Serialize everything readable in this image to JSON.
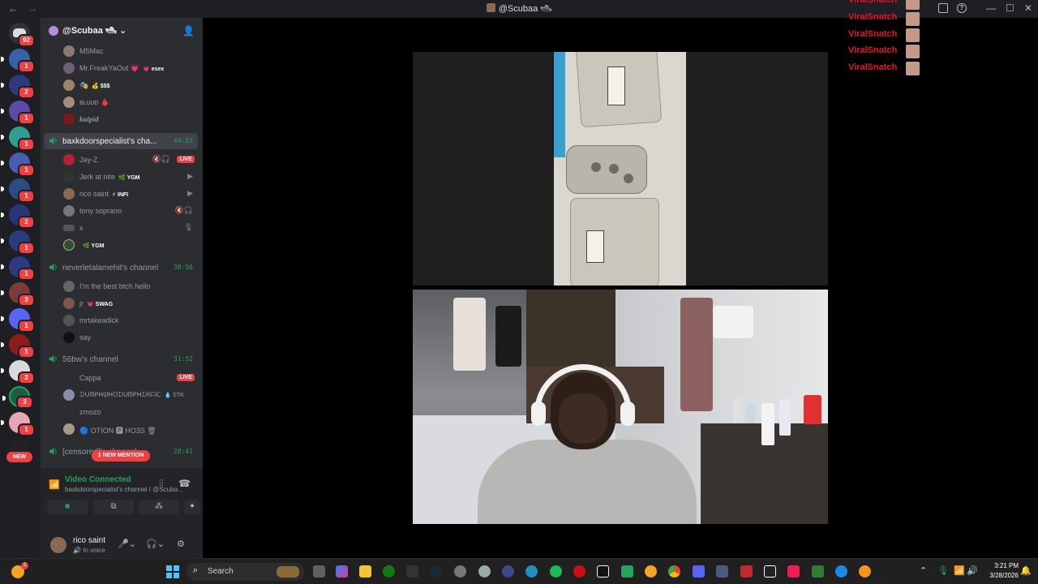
{
  "window": {
    "title": "@Scubaa 🛥",
    "nav_back": "←",
    "nav_forward": "→"
  },
  "server_rail": {
    "home_badge": "92",
    "badges": [
      "1",
      "2",
      "1",
      "1",
      "1",
      "1",
      "2",
      "1",
      "1",
      "3",
      "1",
      "1",
      "2",
      "3",
      "1"
    ],
    "new_pill": "NEW"
  },
  "sidebar": {
    "server_name": "@Scubaa 🛥",
    "members_top": [
      {
        "name": "M5Mac",
        "tag": ""
      },
      {
        "name": "Mr.FreakYaOut 💗",
        "tag": "💗 esex"
      },
      {
        "name": "🎭",
        "tag": "💰 $$$"
      },
      {
        "name": "ʙʟᴜᴜᴅ 🩸",
        "tag": ""
      },
      {
        "name": "kuipid",
        "tag": ""
      }
    ],
    "channel_1": {
      "name": "baxkdoorspecialist's cha...",
      "time": "44:53"
    },
    "channel_1_members": [
      {
        "name": "Jay-Z",
        "tag": "",
        "live": "LIVE"
      },
      {
        "name": "Jerk at nite",
        "tag": "🌿 YGM"
      },
      {
        "name": "rico saint",
        "tag": "⚡ INFI"
      },
      {
        "name": "tony soprano",
        "tag": ""
      },
      {
        "name": "x",
        "tag": ""
      },
      {
        "name": "",
        "tag": "🌿 YGM"
      }
    ],
    "channel_2": {
      "name": "neverletalamehit's channel",
      "time": "38:56"
    },
    "channel_2_members": [
      {
        "name": "I'm the best btch hello",
        "tag": ""
      },
      {
        "name": "jr",
        "tag": "💗 SWAG"
      },
      {
        "name": "mrtakeadick",
        "tag": ""
      },
      {
        "name": "say",
        "tag": ""
      }
    ],
    "channel_3": {
      "name": "56bw's channel",
      "time": "31:52"
    },
    "channel_3_members": [
      {
        "name": "Cappa",
        "tag": "",
        "live": "LIVE"
      },
      {
        "name": "ᗪᑌᗰᑭᕼᗯᕼOᗪᑌᗰᑭᕼᗪᖇᗩᑕ",
        "tag": "💧 STK"
      },
      {
        "name": "zmozo",
        "tag": ""
      },
      {
        "name": "🔵 OTION 🅿 HO3S 🗑",
        "tag": ""
      }
    ],
    "channel_4": {
      "name": "[censored]'s channel",
      "time": "28:41"
    },
    "mention_pill": "1 NEW MENTION"
  },
  "voice": {
    "status": "Video Connected",
    "subtitle": "baxkdoorspecialist's channel / @Scuba...",
    "buttons": [
      "video",
      "screen-share",
      "activities",
      "soundboard"
    ]
  },
  "user": {
    "name": "rico saint",
    "status": "In voice"
  },
  "overlay": {
    "label": "ViralSnatch",
    "rows": 5
  },
  "taskbar": {
    "search_placeholder": "Search",
    "weather_badge": "3",
    "time": "3:21 PM",
    "date": "3/28/2026"
  },
  "colors": {
    "accent_green": "#23a55a",
    "live_red": "#f23f43",
    "overlay_red": "#e8112d",
    "sidebar_bg": "#2b2d31",
    "rail_bg": "#1e1f22"
  }
}
